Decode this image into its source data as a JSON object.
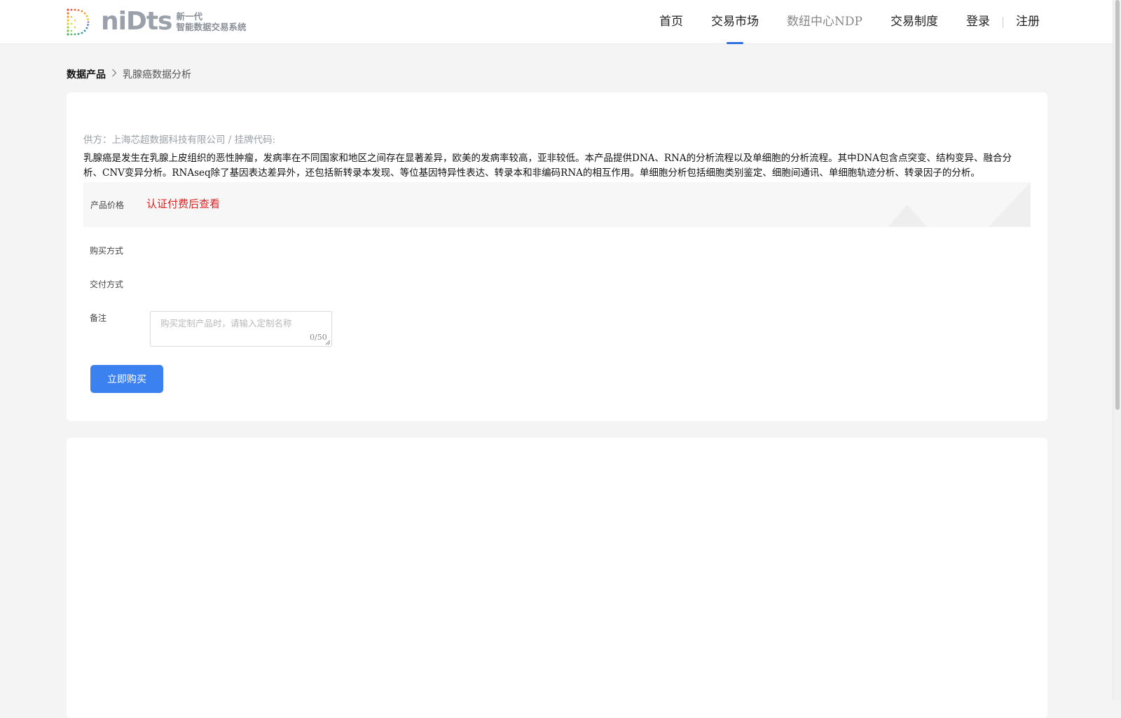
{
  "header": {
    "logo": {
      "word": "niDts",
      "tag_line1": "新一代",
      "tag_line2": "智能数据交易系统"
    },
    "nav": [
      {
        "label": "首页",
        "active": false
      },
      {
        "label": "交易市场",
        "active": true
      },
      {
        "label": "数纽中心NDP",
        "active": false
      },
      {
        "label": "交易制度",
        "active": false
      }
    ],
    "login_label": "登录",
    "register_label": "注册"
  },
  "breadcrumb": {
    "root": "数据产品",
    "current": "乳腺癌数据分析"
  },
  "product": {
    "supplier_line": "供方：上海芯超数据科技有限公司 / 挂牌代码:",
    "description": "乳腺癌是发生在乳腺上皮组织的恶性肿瘤，发病率在不同国家和地区之间存在显著差异，欧美的发病率较高，亚非较低。本产品提供DNA、RNA的分析流程以及单细胞的分析流程。其中DNA包含点突变、结构变异、融合分析、CNV变异分析。RNAseq除了基因表达差异外，还包括新转录本发现、等位基因特异性表达、转录本和非编码RNA的相互作用。单细胞分析包括细胞类别鉴定、细胞间通讯、单细胞轨迹分析、转录因子的分析。",
    "price_label": "产品价格",
    "price_value": "认证付费后查看",
    "purchase_method_label": "购买方式",
    "delivery_method_label": "交付方式",
    "remark_label": "备注",
    "remark_placeholder": "购买定制产品时，请输入定制名称",
    "remark_value": "",
    "remark_count": "0/50",
    "buy_button_label": "立即购买"
  },
  "colors": {
    "accent": "#3b82f0",
    "nav_indicator": "#2f6fe0",
    "price_red": "#e02020"
  }
}
